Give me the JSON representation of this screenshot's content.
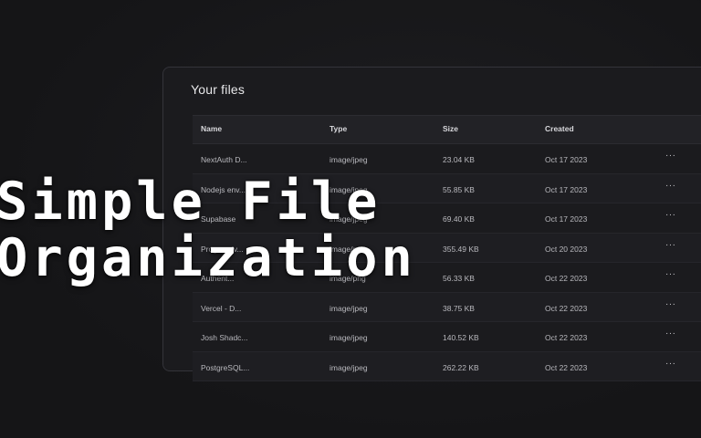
{
  "panel": {
    "title": "Your files"
  },
  "columns": {
    "name": "Name",
    "type": "Type",
    "size": "Size",
    "created": "Created"
  },
  "rows": [
    {
      "name": "NextAuth D...",
      "type": "image/jpeg",
      "size": "23.04 KB",
      "created": "Oct 17 2023",
      "actions": "···"
    },
    {
      "name": "Nodejs env...",
      "type": "image/jpeg",
      "size": "55.85 KB",
      "created": "Oct 17 2023",
      "actions": "···"
    },
    {
      "name": "Supabase",
      "type": "image/jpeg",
      "size": "69.40 KB",
      "created": "Oct 17 2023",
      "actions": "···"
    },
    {
      "name": "Progressiv...",
      "type": "image/png",
      "size": "355.49 KB",
      "created": "Oct 20 2023",
      "actions": "···"
    },
    {
      "name": "Authent...",
      "type": "image/png",
      "size": "56.33 KB",
      "created": "Oct 22 2023",
      "actions": "···"
    },
    {
      "name": "Vercel - D...",
      "type": "image/jpeg",
      "size": "38.75 KB",
      "created": "Oct 22 2023",
      "actions": "···"
    },
    {
      "name": "Josh Shadc...",
      "type": "image/jpeg",
      "size": "140.52 KB",
      "created": "Oct 22 2023",
      "actions": "···"
    },
    {
      "name": "PostgreSQL...",
      "type": "image/jpeg",
      "size": "262.22 KB",
      "created": "Oct 22 2023",
      "actions": "···"
    }
  ],
  "overlay": {
    "line1": "Simple File",
    "line2": "Organization"
  },
  "colors": {
    "background": "#161618",
    "panel": "#1b1b1e",
    "text": "#e8e8ea"
  }
}
